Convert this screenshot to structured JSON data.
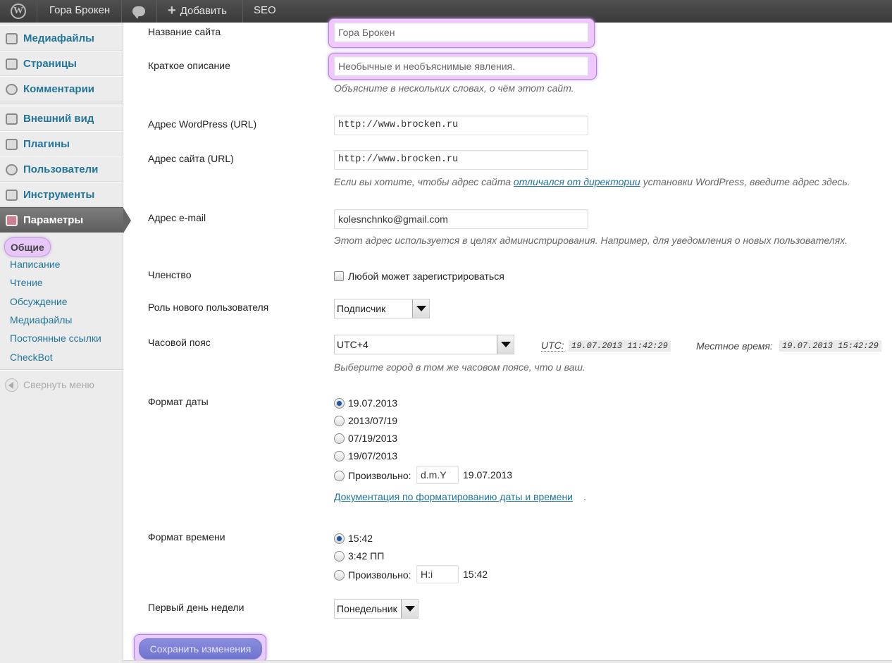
{
  "adminbar": {
    "site_name": "Гора Брокен",
    "add_new": "Добавить",
    "seo": "SEO"
  },
  "sidebar": {
    "items": [
      {
        "label": "Медиафайлы",
        "icon": "media-icon"
      },
      {
        "label": "Страницы",
        "icon": "pages-icon"
      },
      {
        "label": "Комментарии",
        "icon": "comments-icon"
      },
      {
        "label": "Внешний вид",
        "icon": "appearance-icon"
      },
      {
        "label": "Плагины",
        "icon": "plugins-icon"
      },
      {
        "label": "Пользователи",
        "icon": "users-icon"
      },
      {
        "label": "Инструменты",
        "icon": "tools-icon"
      },
      {
        "label": "Параметры",
        "icon": "settings-icon"
      }
    ],
    "submenu": [
      "Общие",
      "Написание",
      "Чтение",
      "Обсуждение",
      "Медиафайлы",
      "Постоянные ссылки",
      "CheckBot"
    ],
    "collapse": "Свернуть меню"
  },
  "form": {
    "site_title_label": "Название сайта",
    "site_title_value": "Гора Брокен",
    "tagline_label": "Краткое описание",
    "tagline_value": "Необычные и необъяснимые явления.",
    "tagline_desc": "Объясните в нескольких словах, о чём этот сайт.",
    "wp_url_label": "Адрес WordPress (URL)",
    "wp_url_value": "http://www.brocken.ru",
    "site_url_label": "Адрес сайта (URL)",
    "site_url_value": "http://www.brocken.ru",
    "site_url_desc_pre": "Если вы хотите, чтобы адрес сайта ",
    "site_url_desc_link": "отличался от директории",
    "site_url_desc_post": " установки WordPress, введите адрес здесь.",
    "email_label": "Адрес e-mail",
    "email_value": "kolesnchnko@gmail.com",
    "email_desc": "Этот адрес используется в целях администрирования. Например, для уведомления о новых пользователях.",
    "membership_label": "Членство",
    "membership_checkbox": "Любой может зарегистрироваться",
    "role_label": "Роль нового пользователя",
    "role_value": "Подписчик",
    "timezone_label": "Часовой пояс",
    "timezone_value": "UTC+4",
    "utc_label": "UTC:",
    "utc_time": "19.07.2013 11:42:29",
    "local_label": "Местное время:",
    "local_time": "19.07.2013 15:42:29",
    "timezone_desc": "Выберите город в том же часовом поясе, что и ваш.",
    "date_format_label": "Формат даты",
    "date_options": [
      "19.07.2013",
      "2013/07/19",
      "07/19/2013",
      "19/07/2013"
    ],
    "custom_label": "Произвольно:",
    "date_custom_value": "d.m.Y",
    "date_custom_preview": "19.07.2013",
    "date_doc_link": "Документация по форматированию даты и времени",
    "date_doc_dot": ".",
    "time_format_label": "Формат времени",
    "time_options": [
      "15:42",
      "3:42 ПП"
    ],
    "time_custom_value": "H:i",
    "time_custom_preview": "15:42",
    "week_label": "Первый день недели",
    "week_value": "Понедельник",
    "save_label": "Сохранить изменения"
  }
}
